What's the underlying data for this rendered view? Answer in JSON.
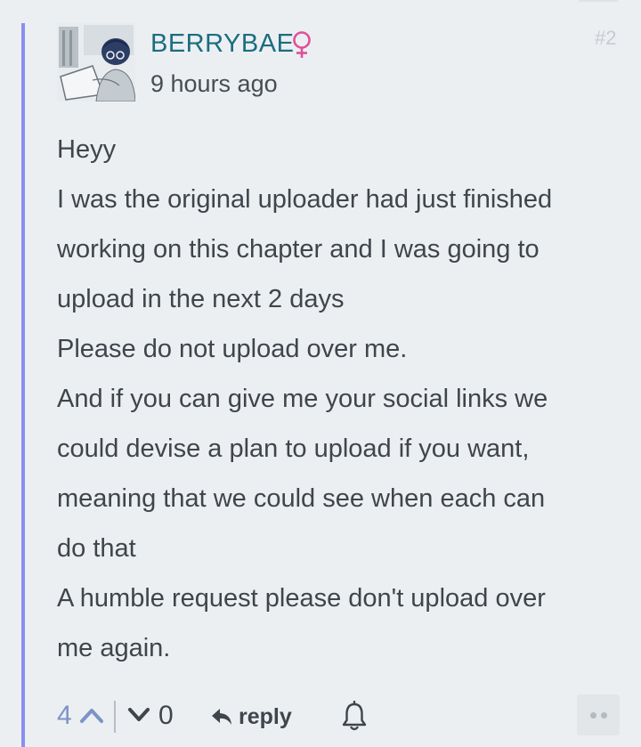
{
  "comment": {
    "username": "BERRYBAE",
    "timestamp": "9 hours ago",
    "comment_number": "#2",
    "lines": [
      "Heyy",
      "I was the original uploader had just finished",
      "working on this chapter and I was going to",
      "upload in the next 2 days",
      "Please do not upload over me.",
      "And if you can give me your social links we",
      "could devise a plan to upload if you want,",
      "meaning that we could see when each can",
      "do that",
      "A humble request please don't upload over",
      "me again."
    ]
  },
  "footer": {
    "upvotes": "4",
    "downvotes": "0",
    "reply_label": "reply"
  },
  "icons": {
    "gender": "female-symbol-icon",
    "upvote": "chevron-up-icon",
    "downvote": "chevron-down-icon",
    "reply": "reply-arrow-icon",
    "subscribe": "bell-icon",
    "more": "more-dots-icon"
  },
  "colors": {
    "thread_line": "#8b8ff0",
    "username": "#1b6d80",
    "gender": "#e0509a",
    "upvote": "#7c93c6"
  }
}
